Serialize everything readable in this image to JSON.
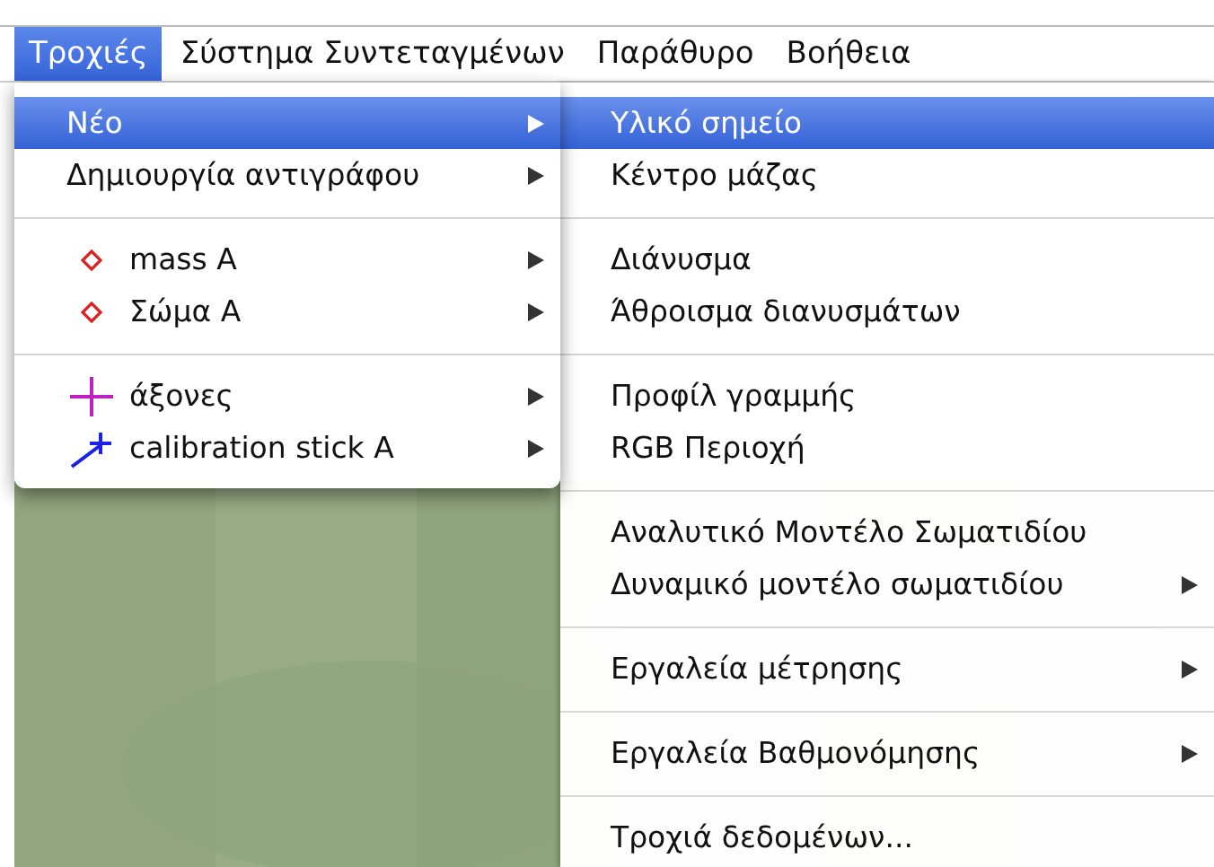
{
  "menubar": [
    {
      "label": "Τροχιές",
      "selected": true
    },
    {
      "label": "Σύστημα Συντεταγμένων",
      "selected": false
    },
    {
      "label": "Παράθυρο",
      "selected": false
    },
    {
      "label": "Βοήθεια",
      "selected": false
    }
  ],
  "menu": {
    "groups": [
      [
        {
          "label": "Νέο",
          "submenu": true,
          "selected": true
        },
        {
          "label": "Δημιουργία αντιγράφου",
          "submenu": true,
          "selected": false
        }
      ],
      [
        {
          "kind": "mass",
          "label": "mass A",
          "submenu": true,
          "selected": false
        },
        {
          "kind": "mass",
          "label": "Σώμα A",
          "submenu": true,
          "selected": false
        }
      ],
      [
        {
          "kind": "axes",
          "label": "άξονες",
          "submenu": true,
          "selected": false
        },
        {
          "kind": "calibration",
          "label": "calibration stick A",
          "submenu": true,
          "selected": false
        }
      ]
    ]
  },
  "submenu": {
    "groups": [
      [
        {
          "label": "Υλικό σημείο",
          "submenu": false,
          "selected": true
        },
        {
          "label": "Κέντρο μάζας",
          "submenu": false,
          "selected": false
        }
      ],
      [
        {
          "label": "Διάνυσμα",
          "submenu": false,
          "selected": false
        },
        {
          "label": "Άθροισμα διανυσμάτων",
          "submenu": false,
          "selected": false
        }
      ],
      [
        {
          "label": "Προφίλ γραμμής",
          "submenu": false,
          "selected": false
        },
        {
          "label": "RGB Περιοχή",
          "submenu": false,
          "selected": false
        }
      ],
      [
        {
          "label": "Αναλυτικό Μοντέλο Σωματιδίου",
          "submenu": false,
          "selected": false
        },
        {
          "label": "Δυναμικό μοντέλο σωματιδίου",
          "submenu": true,
          "selected": false
        }
      ],
      [
        {
          "label": "Εργαλεία μέτρησης",
          "submenu": true,
          "selected": false
        }
      ],
      [
        {
          "label": "Εργαλεία Βαθμονόμησης",
          "submenu": true,
          "selected": false
        }
      ],
      [
        {
          "label": "Τροχιά δεδομένων...",
          "submenu": false,
          "selected": false
        }
      ]
    ]
  }
}
